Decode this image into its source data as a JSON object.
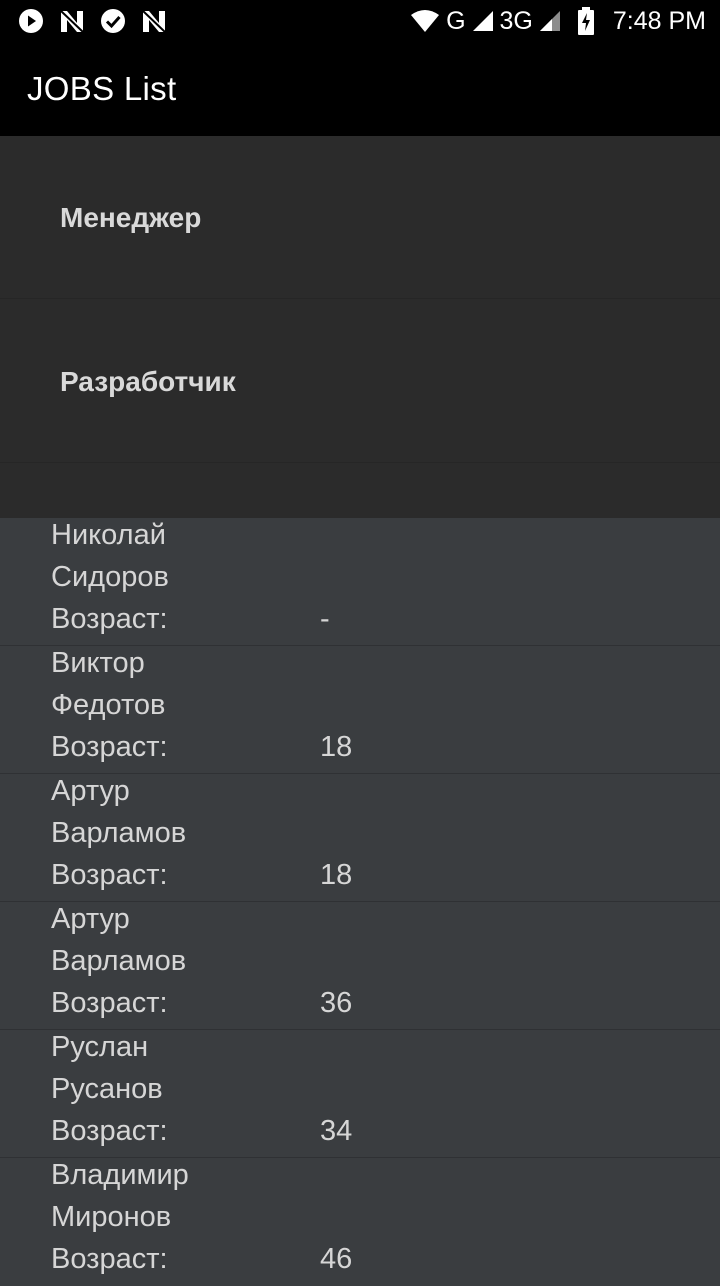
{
  "status_bar": {
    "network": "G",
    "network2": "3G",
    "time": "7:48 PM"
  },
  "app_bar": {
    "title": "JOBS List"
  },
  "groups": [
    {
      "label": "Менеджер"
    },
    {
      "label": "Разработчик"
    }
  ],
  "employees": [
    {
      "first_name": "Николай",
      "last_name": "Сидоров",
      "age_label": "Возраст:",
      "age": "-"
    },
    {
      "first_name": "Виктор",
      "last_name": "Федотов",
      "age_label": "Возраст:",
      "age": "18"
    },
    {
      "first_name": "Артур",
      "last_name": "Варламов",
      "age_label": "Возраст:",
      "age": "18"
    },
    {
      "first_name": "Артур",
      "last_name": "Варламов",
      "age_label": "Возраст:",
      "age": "36"
    },
    {
      "first_name": "Руслан",
      "last_name": "Русанов",
      "age_label": "Возраст:",
      "age": "34"
    },
    {
      "first_name": "Владимир",
      "last_name": "Миронов",
      "age_label": "Возраст:",
      "age": "46"
    }
  ]
}
